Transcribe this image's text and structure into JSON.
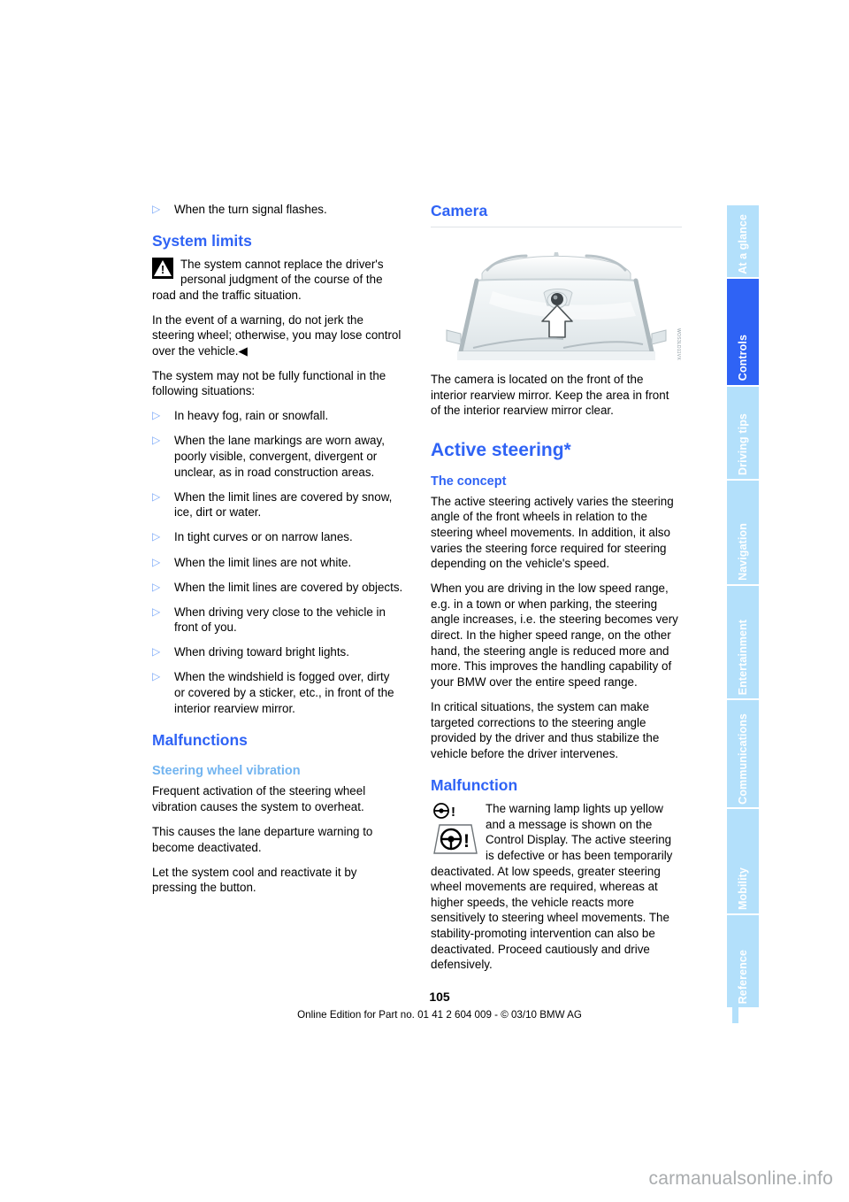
{
  "document": {
    "page_number": "105",
    "imprint": "Online Edition for Part no. 01 41 2 604 009 - © 03/10 BMW AG",
    "watermark": "carmanualsonline.info"
  },
  "tabs": [
    {
      "label": "At a glance",
      "active": false
    },
    {
      "label": "Controls",
      "active": true
    },
    {
      "label": "Driving tips",
      "active": false
    },
    {
      "label": "Navigation",
      "active": false
    },
    {
      "label": "Entertainment",
      "active": false
    },
    {
      "label": "Communications",
      "active": false
    },
    {
      "label": "Mobility",
      "active": false
    },
    {
      "label": "Reference",
      "active": false
    }
  ],
  "left_column": {
    "lead_bullet": "When the turn signal flashes.",
    "system_limits_heading": "System limits",
    "warning_note_inline": "The system cannot replace the driver's personal judgment of the course of the",
    "warning_note_rest": "road and the traffic situation.",
    "warning_note_p2": "In the event of a warning, do not jerk the steering wheel; otherwise, you may lose control over the vehicle.◀",
    "intro": "The system may not be fully functional in the following situations:",
    "situations": [
      "In heavy fog, rain or snowfall.",
      "When the lane markings are worn away, poorly visible, convergent, divergent or unclear, as in road construction areas.",
      "When the limit lines are covered by snow, ice, dirt or water.",
      "In tight curves or on narrow lanes.",
      "When the limit lines are not white.",
      "When the limit lines are covered by objects.",
      "When driving very close to the vehicle in front of you.",
      "When driving toward bright lights.",
      "When the windshield is fogged over, dirty or covered by a sticker, etc., in front of the interior rearview mirror."
    ],
    "malfunctions_heading": "Malfunctions",
    "vibration_heading": "Steering wheel vibration",
    "vibration_p1": "Frequent activation of the steering wheel vibration causes the system to overheat.",
    "vibration_p2": "This causes the lane departure warning to become deactivated.",
    "vibration_p3": "Let the system cool and reactivate it by pressing the button."
  },
  "right_column": {
    "camera_heading": "Camera",
    "figure_code": "WOS3LD11VX",
    "camera_caption": "The camera is located on the front of the interior rearview mirror. Keep the area in front of the interior rearview mirror clear.",
    "active_steering_heading": "Active steering*",
    "concept_heading": "The concept",
    "concept_p1": "The active steering actively varies the steering angle of the front wheels in relation to the steering wheel movements. In addition, it also varies the steering force required for steering depending on the vehicle's speed.",
    "concept_p2": "When you are driving in the low speed range, e.g. in a town or when parking, the steering angle increases, i.e. the steering becomes very direct. In the higher speed range, on the other hand, the steering angle is reduced more and more. This improves the handling capability of your BMW over the entire speed range.",
    "concept_p3": "In critical situations, the system can make targeted corrections to the steering angle provided by the driver and thus stabilize the vehicle before the driver intervenes.",
    "malfunction_heading": "Malfunction",
    "malfunction_lead": "The warning lamp lights up yellow and a message is shown on the Control Display. The active steering is defective or has been temporarily",
    "malfunction_rest": "deactivated. At low speeds, greater steering wheel movements are required, whereas at higher speeds, the vehicle reacts more sensitively to steering wheel movements. The stability-promoting intervention can also be deactivated. Proceed cautiously and drive defensively."
  },
  "colors": {
    "accent_blue": "#2f63f5",
    "tab_inactive": "#b3e0fb",
    "subheading_light": "#72b4f0",
    "bullet": "#7aa8f7"
  }
}
